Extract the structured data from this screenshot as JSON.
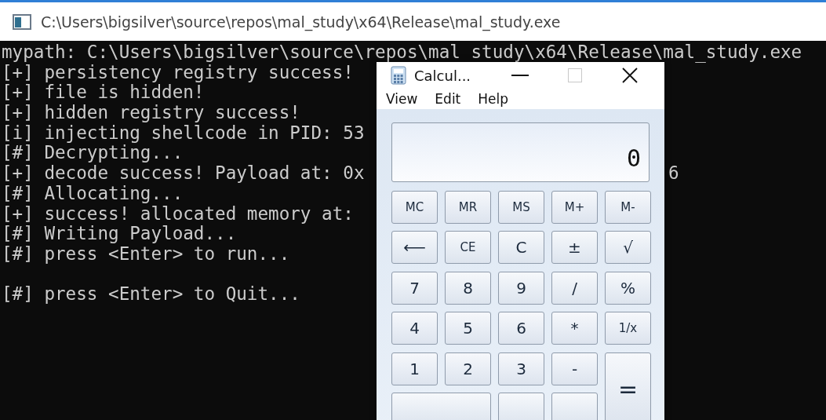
{
  "console": {
    "title": "C:\\Users\\bigsilver\\source\\repos\\mal_study\\x64\\Release\\mal_study.exe",
    "lines": [
      {
        "text": "mypath: C:\\Users\\bigsilver\\source\\repos\\mal_study\\x64\\Release\\mal_study.exe"
      },
      {
        "text": "[+] persistency registry success!"
      },
      {
        "text": "[+] file is hidden!"
      },
      {
        "text": "[+] hidden registry success!"
      },
      {
        "text": "[i] injecting shellcode in PID: 53"
      },
      {
        "text": "[#] Decrypting..."
      },
      {
        "text": "[+] decode success! Payload at: 0x",
        "tail": "6"
      },
      {
        "text": "[#] Allocating..."
      },
      {
        "text": "[+] success! allocated memory at:"
      },
      {
        "text": "[#] Writing Payload..."
      },
      {
        "text": "[#] press <Enter> to run..."
      },
      {
        "kind": "blank"
      },
      {
        "text": "[#] press <Enter> to Quit..."
      }
    ]
  },
  "calculator": {
    "title": "Calcul...",
    "menu": [
      "View",
      "Edit",
      "Help"
    ],
    "display": "0",
    "keys": [
      {
        "label": "MC",
        "kind": "key"
      },
      {
        "label": "MR",
        "kind": "key"
      },
      {
        "label": "MS",
        "kind": "key"
      },
      {
        "label": "M+",
        "kind": "key"
      },
      {
        "label": "M-",
        "kind": "key"
      },
      {
        "label": "⟵",
        "kind": "key"
      },
      {
        "label": "CE",
        "kind": "key"
      },
      {
        "label": "C",
        "kind": "key"
      },
      {
        "label": "±",
        "kind": "key"
      },
      {
        "label": "√",
        "kind": "key"
      },
      {
        "label": "7",
        "kind": "key"
      },
      {
        "label": "8",
        "kind": "key"
      },
      {
        "label": "9",
        "kind": "key"
      },
      {
        "label": "/",
        "kind": "key"
      },
      {
        "label": "%",
        "kind": "key"
      },
      {
        "label": "4",
        "kind": "key"
      },
      {
        "label": "5",
        "kind": "key"
      },
      {
        "label": "6",
        "kind": "key"
      },
      {
        "label": "*",
        "kind": "key"
      },
      {
        "label": "1/x",
        "kind": "key"
      },
      {
        "label": "1",
        "kind": "key"
      },
      {
        "label": "2",
        "kind": "key"
      },
      {
        "label": "3",
        "kind": "key"
      },
      {
        "label": "-",
        "kind": "key"
      },
      {
        "label": "=",
        "kind": "tall"
      },
      {
        "kind": "wide"
      },
      {
        "kind": "key"
      },
      {
        "kind": "key"
      }
    ]
  }
}
